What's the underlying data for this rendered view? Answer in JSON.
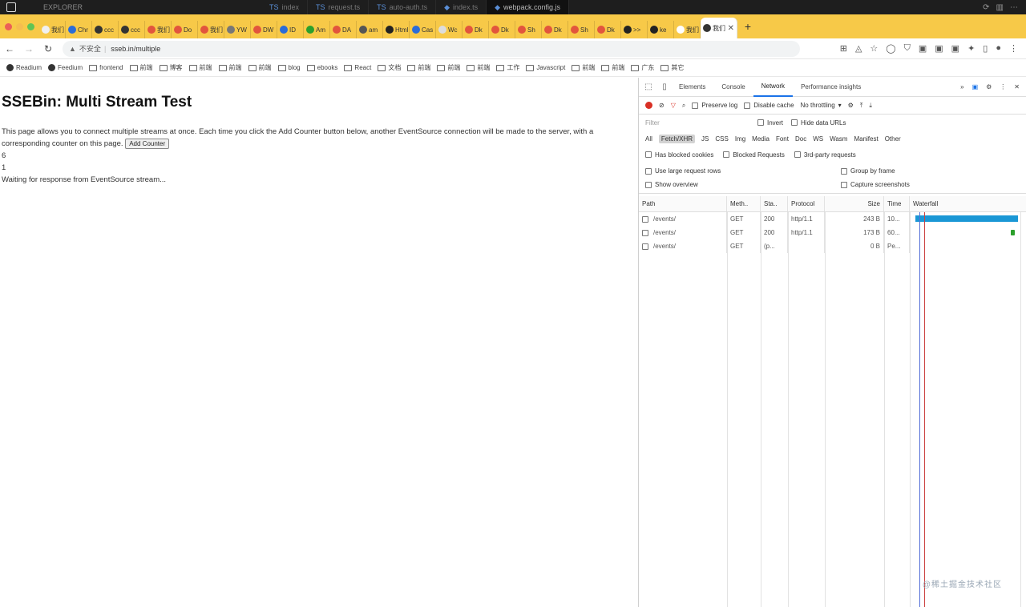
{
  "os_bar": {
    "app_name": "EXPLORER",
    "ide_tabs": [
      "index",
      "request.ts",
      "auto-auth.ts",
      "index.ts",
      "webpack.config.js"
    ],
    "active_ide_tab_index": 4
  },
  "browser_tabs": [
    "我们",
    "Chr",
    "ccc",
    "ccc",
    "我们",
    "Do",
    "我们",
    "YW",
    "DW",
    "ID",
    "Am",
    "DA",
    "am",
    "Html",
    "Cas",
    "Wc",
    "Dk",
    "Dk",
    "Sh",
    "Dk",
    "Sh",
    "Dk",
    ">>",
    "ke",
    "我们"
  ],
  "active_tab_label": "我们",
  "address": {
    "security_label": "不安全",
    "url": "sseb.in/multiple"
  },
  "bookmarks": [
    "Readium",
    "Feedium",
    "frontend",
    "前端",
    "博客",
    "前端",
    "前端",
    "前端",
    "blog",
    "ebooks",
    "React",
    "文档",
    "前端",
    "前端",
    "前端",
    "工作",
    "Javascript",
    "前端",
    "前端",
    "广东",
    "其它"
  ],
  "page": {
    "title": "SSEBin: Multi Stream Test",
    "intro": "This page allows you to connect multiple streams at once. Each time you click the Add Counter button below, another EventSource connection will be made to the server, with a corresponding counter on this page.",
    "add_counter_label": "Add Counter",
    "counters": [
      "6",
      "1"
    ],
    "waiting_text": "Waiting for response from EventSource stream..."
  },
  "devtools": {
    "tabs": [
      "Elements",
      "Console",
      "Network",
      "Performance insights"
    ],
    "active_tab": "Network",
    "toolbar": {
      "preserve_log": "Preserve log",
      "disable_cache": "Disable cache",
      "throttling": "No throttling"
    },
    "filter": {
      "placeholder": "Filter",
      "invert": "Invert",
      "hide_data_urls": "Hide data URLs"
    },
    "types": [
      "All",
      "Fetch/XHR",
      "JS",
      "CSS",
      "Img",
      "Media",
      "Font",
      "Doc",
      "WS",
      "Wasm",
      "Manifest",
      "Other"
    ],
    "active_type": "Fetch/XHR",
    "options_row": [
      "Has blocked cookies",
      "Blocked Requests",
      "3rd-party requests"
    ],
    "options_grid": [
      "Use large request rows",
      "Group by frame",
      "Show overview",
      "Capture screenshots"
    ],
    "columns": [
      "Path",
      "Meth..",
      "Sta..",
      "Protocol",
      "Size",
      "Time",
      "Waterfall"
    ],
    "requests": [
      {
        "path": "/events/",
        "method": "GET",
        "status": "200",
        "protocol": "http/1.1",
        "size": "243 B",
        "time": "10..."
      },
      {
        "path": "/events/",
        "method": "GET",
        "status": "200",
        "protocol": "http/1.1",
        "size": "173 B",
        "time": "60..."
      },
      {
        "path": "/events/",
        "method": "GET",
        "status": "(p...",
        "protocol": "",
        "size": "0 B",
        "time": "Pe..."
      }
    ],
    "waterfall": [
      {
        "start": 0.05,
        "end": 0.98
      },
      {
        "start": null,
        "end": null
      },
      {
        "start": null,
        "end": null
      }
    ]
  },
  "watermark": "@稀土掘金技术社区",
  "colors": {
    "tab_strip": "#f7c948",
    "accent": "#1a73e8",
    "record": "#d93025",
    "waterfall": "#1a97d5"
  }
}
